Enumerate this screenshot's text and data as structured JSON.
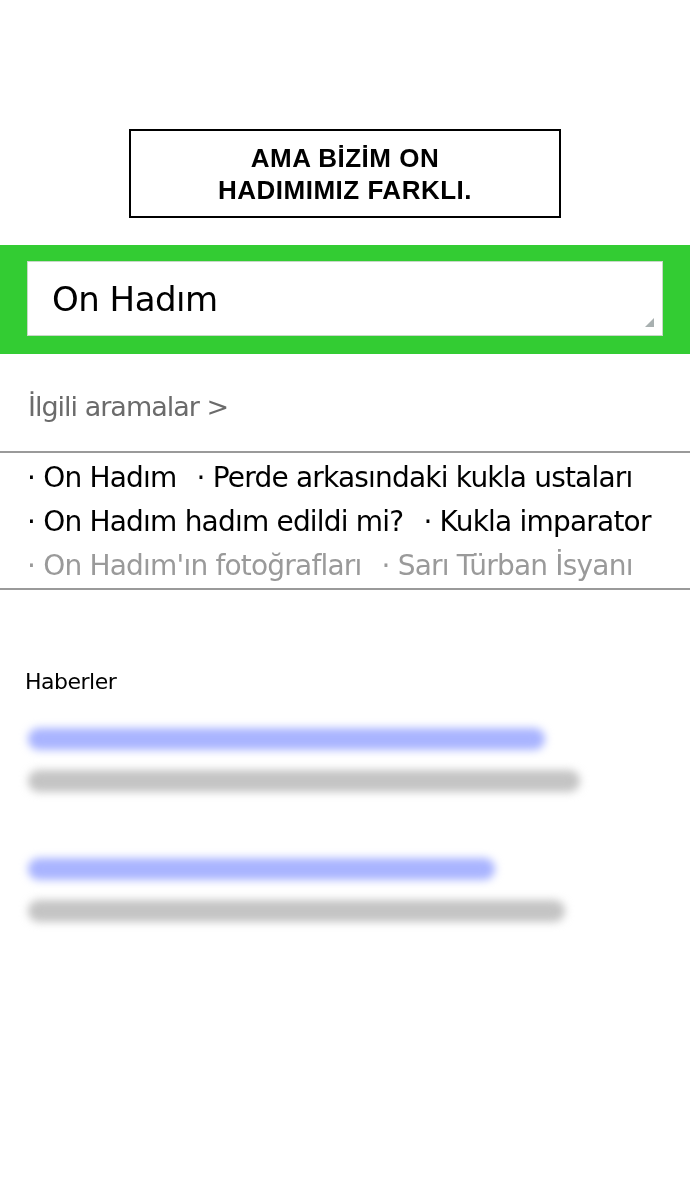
{
  "caption": {
    "text": "AMA BİZİM ON\nHADIMIMIZ FARKLI."
  },
  "search": {
    "value": "On Hadım"
  },
  "related": {
    "heading": "İlgili aramalar >",
    "rows": [
      [
        {
          "text": "· On Hadım",
          "dimmed": false
        },
        {
          "text": "· Perde arkasındaki kukla ustaları",
          "dimmed": false
        }
      ],
      [
        {
          "text": "· On Hadım hadım edildi mi?",
          "dimmed": false
        },
        {
          "text": "· Kukla imparator",
          "dimmed": false
        }
      ],
      [
        {
          "text": "· On Hadım'ın fotoğrafları",
          "dimmed": true
        },
        {
          "text": "· Sarı Türban İsyanı",
          "dimmed": true
        }
      ]
    ]
  },
  "news": {
    "heading": "Haberler",
    "items": [
      {
        "blurred": true
      },
      {
        "blurred": true
      }
    ]
  }
}
